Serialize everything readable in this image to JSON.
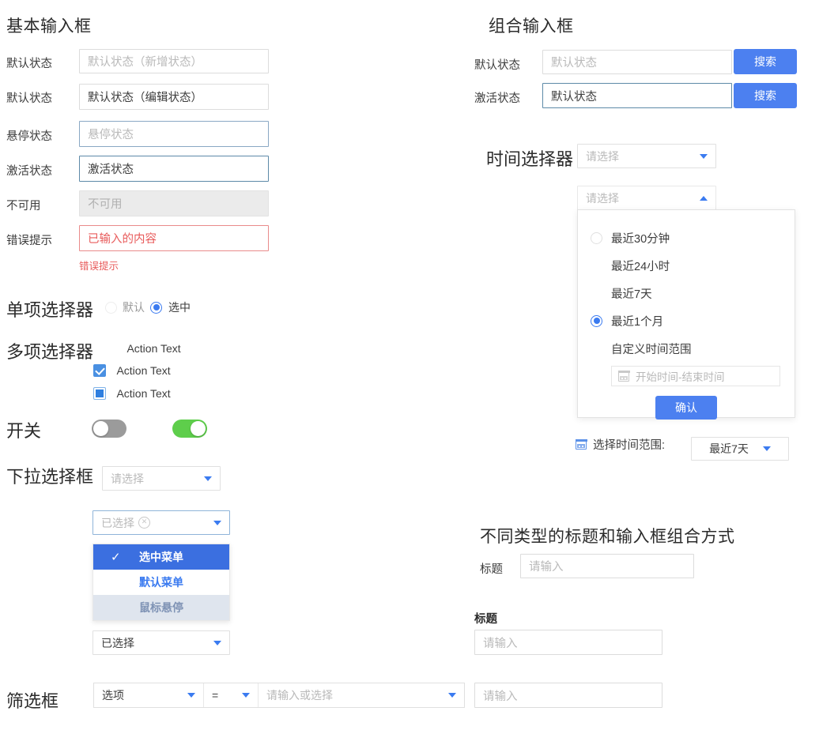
{
  "basic_inputs": {
    "title": "基本输入框",
    "rows": [
      {
        "label": "默认状态",
        "value": "默认状态（新增状态）",
        "state": "placeholder"
      },
      {
        "label": "默认状态",
        "value": "默认状态（编辑状态）",
        "state": "filled"
      },
      {
        "label": "悬停状态",
        "value": "悬停状态",
        "state": "hover-placeholder"
      },
      {
        "label": "激活状态",
        "value": "激活状态",
        "state": "active-filled"
      },
      {
        "label": "不可用",
        "value": "不可用",
        "state": "disabled"
      },
      {
        "label": "错误提示",
        "value": "已输入的内容",
        "state": "error"
      }
    ],
    "error_message": "错误提示"
  },
  "radio_group": {
    "label": "单项选择器",
    "options": [
      {
        "text": "默认",
        "checked": false
      },
      {
        "text": "选中",
        "checked": true
      }
    ]
  },
  "checkbox_group": {
    "label": "多项选择器",
    "options": [
      {
        "text": "Action Text",
        "state": "unchecked"
      },
      {
        "text": "Action Text",
        "state": "checked"
      },
      {
        "text": "Action Text",
        "state": "indeterminate"
      }
    ]
  },
  "switches": {
    "label": "开关",
    "items": [
      {
        "state": "off",
        "color": "#9b9b9b"
      },
      {
        "state": "on",
        "color": "#5ece4b"
      }
    ]
  },
  "dropdown_select": {
    "label": "下拉选择框",
    "trigger_placeholder": "请选择",
    "second_trigger_value": "已选择",
    "second_trigger_clear_icon": "clear-circle-icon",
    "menu_items": [
      {
        "text": "选中菜单",
        "state": "selected",
        "icon": "check-icon"
      },
      {
        "text": "默认菜单",
        "state": "default"
      },
      {
        "text": "鼠标悬停",
        "state": "hovered"
      }
    ],
    "third_trigger_value": "已选择"
  },
  "filter_box": {
    "label": "筛选框",
    "field_value": "选项",
    "operator_value": "=",
    "value_placeholder": "请输入或选择",
    "trailing_input_placeholder": "请输入"
  },
  "combo_inputs": {
    "title": "组合输入框",
    "rows": [
      {
        "label": "默认状态",
        "value": "默认状态",
        "state": "placeholder",
        "button": "搜索"
      },
      {
        "label": "激活状态",
        "value": "默认状态",
        "state": "active-filled",
        "button": "搜索"
      }
    ]
  },
  "time_picker": {
    "label": "时间选择器",
    "collapsed_placeholder": "请选择",
    "expanded_placeholder": "请选择",
    "options": [
      {
        "text": "最近30分钟",
        "checked": false,
        "has_radio": true
      },
      {
        "text": "最近24小时",
        "checked": false,
        "has_radio": false
      },
      {
        "text": "最近7天",
        "checked": false,
        "has_radio": false
      },
      {
        "text": "最近1个月",
        "checked": true,
        "has_radio": true
      },
      {
        "text": "自定义时间范围",
        "checked": false,
        "has_radio": false
      }
    ],
    "date_range_placeholder": "开始时间-结束时间",
    "date_range_icon": "calendar-icon",
    "confirm_button": "确认"
  },
  "time_range_bar": {
    "icon": "calendar-icon",
    "label": "选择时间范围:",
    "value": "最近7天"
  },
  "title_input_combos": {
    "title": "不同类型的标题和输入框组合方式",
    "inline": {
      "label": "标题",
      "placeholder": "请输入"
    },
    "stacked": {
      "label": "标题",
      "placeholder": "请输入"
    }
  },
  "colors": {
    "primary": "#4c80f0",
    "menu_selected": "#3b6fe0",
    "switch_on": "#5ece4b",
    "switch_off": "#9b9b9b",
    "error": "#e85b5b",
    "checkbox_checked": "#4a90e2",
    "placeholder": "#b9b9b9"
  }
}
